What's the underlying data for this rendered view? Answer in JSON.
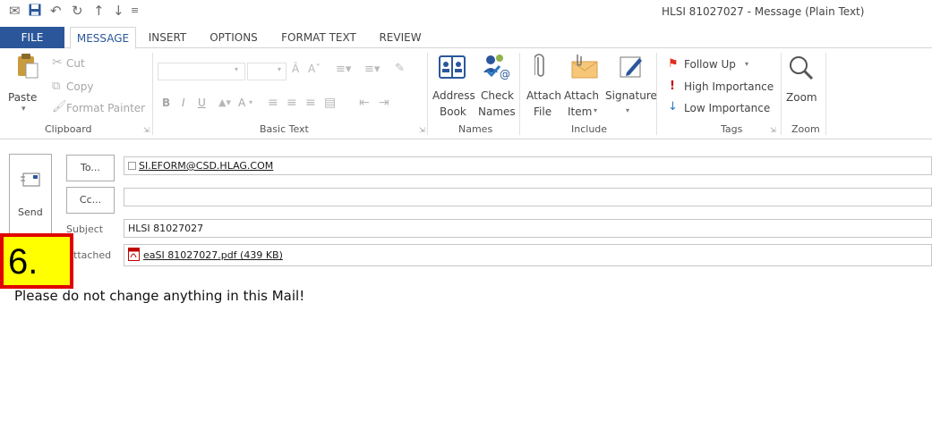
{
  "window": {
    "title": "HLSI 81027027 - Message (Plain Text)"
  },
  "quick_access": [
    "mail-icon",
    "save-icon",
    "undo-icon",
    "redo-icon",
    "up-arrow-icon",
    "down-arrow-icon",
    "customize-icon"
  ],
  "tabs": [
    "FILE",
    "MESSAGE",
    "INSERT",
    "OPTIONS",
    "FORMAT TEXT",
    "REVIEW"
  ],
  "active_tab": "MESSAGE",
  "ribbon": {
    "clipboard": {
      "label": "Clipboard",
      "paste": "Paste",
      "cut": "Cut",
      "copy": "Copy",
      "format_painter": "Format Painter"
    },
    "basic_text": {
      "label": "Basic Text",
      "bold": "B",
      "italic": "I",
      "underline": "U",
      "font_color": "A"
    },
    "names": {
      "label": "Names",
      "address_book": [
        "Address",
        "Book"
      ],
      "check_names": [
        "Check",
        "Names"
      ]
    },
    "include": {
      "label": "Include",
      "attach_file": [
        "Attach",
        "File"
      ],
      "attach_item": [
        "Attach",
        "Item"
      ],
      "signature": "Signature"
    },
    "tags": {
      "label": "Tags",
      "follow_up": "Follow Up",
      "high_importance": "High Importance",
      "low_importance": "Low Importance"
    },
    "zoom": {
      "label": "Zoom",
      "zoom": "Zoom"
    }
  },
  "compose": {
    "send": "Send",
    "to_button": "To...",
    "cc_button": "Cc...",
    "to_value": "SI.EFORM@CSD.HLAG.COM",
    "cc_value": "",
    "subject_label": "Subject",
    "subject_value": "HLSI 81027027",
    "attached_label": "ttached",
    "attachment": "eaSI 81027027.pdf (439 KB)",
    "body": "Please do not change anything in this Mail!"
  },
  "annotation": {
    "step": "6."
  },
  "colors": {
    "file_tab": "#2b579a",
    "flag": "#e0301e",
    "importance_high": "#c00000",
    "badge_fill": "#ffff00",
    "badge_border": "#e00000"
  }
}
